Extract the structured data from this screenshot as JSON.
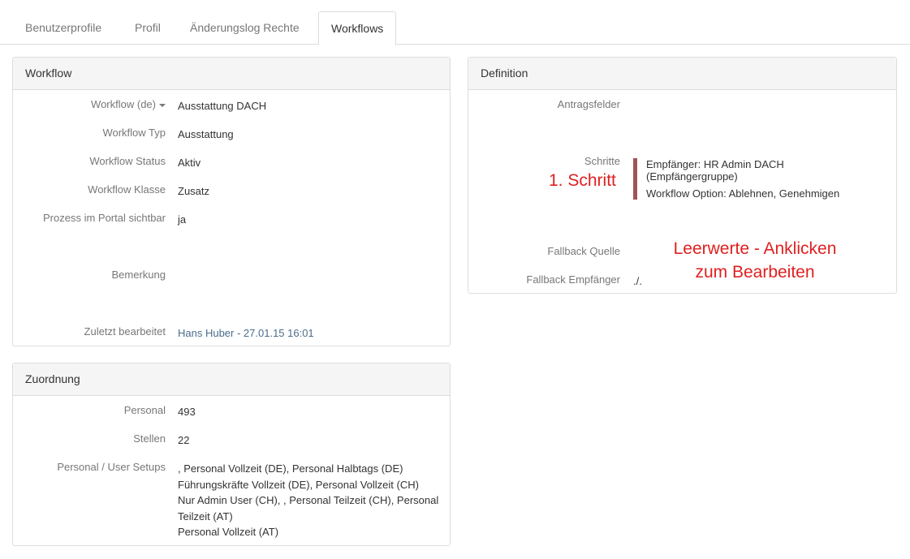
{
  "tabs": [
    {
      "label": "Benutzerprofile",
      "active": false
    },
    {
      "label": "Profil",
      "active": false
    },
    {
      "label": "Änderungslog Rechte",
      "active": false
    },
    {
      "label": "Workflows",
      "active": true
    }
  ],
  "workflow": {
    "title": "Workflow",
    "rows": [
      {
        "label": "Workflow (de)",
        "value": "Ausstattung DACH"
      },
      {
        "label": "Workflow Typ",
        "value": "Ausstattung"
      },
      {
        "label": "Workflow Status",
        "value": "Aktiv"
      },
      {
        "label": "Workflow Klasse",
        "value": "Zusatz"
      },
      {
        "label": "Prozess im Portal sichtbar",
        "value": "ja"
      },
      {
        "label": "Bemerkung",
        "value": ""
      },
      {
        "label": "Zuletzt bearbeitet",
        "value": "Hans Huber - 27.01.15 16:01"
      }
    ]
  },
  "zuordnung": {
    "title": "Zuordnung",
    "rows": [
      {
        "label": "Personal",
        "value": "493"
      },
      {
        "label": "Stellen",
        "value": "22"
      },
      {
        "label": "Personal / User Setups",
        "lines": [
          ", Personal Vollzeit (DE), Personal Halbtags (DE)",
          "Führungskräfte Vollzeit (DE), Personal Vollzeit (CH)",
          "Nur Admin User (CH), , Personal Teilzeit (CH), Personal Teilzeit (AT)",
          "Personal Vollzeit (AT)"
        ]
      }
    ]
  },
  "definition": {
    "title": "Definition",
    "antragsfelder_label": "Antragsfelder",
    "schritte_label": "Schritte",
    "step": {
      "empfaenger": "Empfänger: HR Admin DACH (Empfängergruppe)",
      "option": "Workflow Option: Ablehnen, Genehmigen"
    },
    "fallback_quelle_label": "Fallback Quelle",
    "fallback_empfaenger_label": "Fallback Empfänger",
    "fallback_empfaenger_value": "./."
  },
  "annotations": {
    "step": "1. Schritt",
    "empty_line1": "Leerwerte - Anklicken",
    "empty_line2": "zum Bearbeiten",
    "color": "#e02020"
  },
  "colors": {
    "step_bar": "#a0535a",
    "link": "#4a6d8c",
    "label": "#777777",
    "panel_header_bg": "#f5f5f5",
    "border": "#dddddd"
  }
}
